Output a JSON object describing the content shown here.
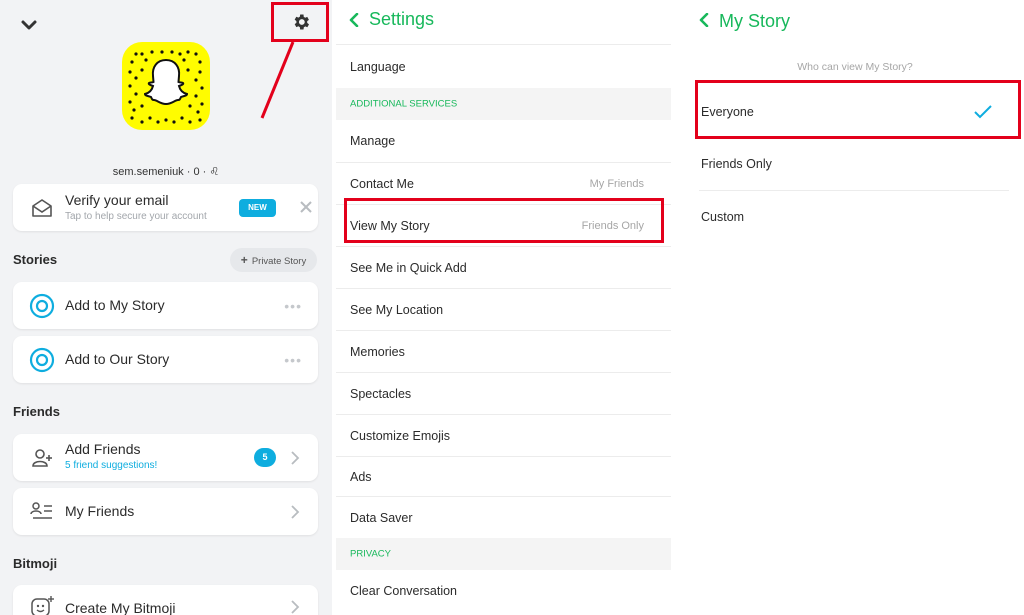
{
  "colors": {
    "accent_green": "#17b85b",
    "accent_blue": "#0eaddf",
    "highlight_red": "#e3001b",
    "snap_yellow": "#fffc00"
  },
  "profile": {
    "username": "sem.semeniuk · 0 · ♌",
    "verify": {
      "title": "Verify your email",
      "subtitle": "Tap to help secure your account",
      "badge": "NEW"
    },
    "stories_heading": "Stories",
    "private_story_label": "Private Story",
    "story_items": [
      {
        "label": "Add to My Story"
      },
      {
        "label": "Add to Our Story"
      }
    ],
    "friends_heading": "Friends",
    "add_friends": {
      "title": "Add Friends",
      "subtitle": "5 friend suggestions!",
      "count": "5"
    },
    "my_friends": "My Friends",
    "bitmoji_heading": "Bitmoji",
    "create_bitmoji": "Create My Bitmoji"
  },
  "settings": {
    "title": "Settings",
    "language": "Language",
    "section_additional": "ADDITIONAL SERVICES",
    "manage": "Manage",
    "contact_me": {
      "label": "Contact Me",
      "value": "My Friends"
    },
    "view_my_story": {
      "label": "View My Story",
      "value": "Friends Only"
    },
    "see_me_quick_add": "See Me in Quick Add",
    "see_my_location": "See My Location",
    "memories": "Memories",
    "spectacles": "Spectacles",
    "customize_emojis": "Customize Emojis",
    "ads": "Ads",
    "data_saver": "Data Saver",
    "section_privacy": "PRIVACY",
    "clear_conversation": "Clear Conversation"
  },
  "my_story": {
    "title": "My Story",
    "question": "Who can view My Story?",
    "options": [
      {
        "label": "Everyone",
        "selected": true
      },
      {
        "label": "Friends Only"
      },
      {
        "label": "Custom"
      }
    ]
  }
}
